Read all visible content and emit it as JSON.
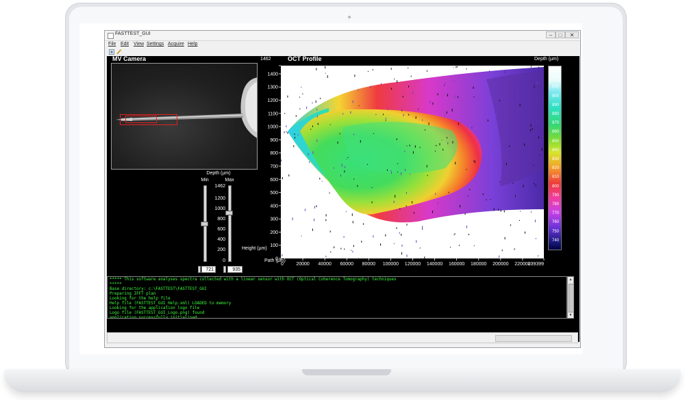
{
  "window": {
    "title": "FASTTEST_GUI",
    "controls": [
      "–",
      "□",
      "✕"
    ]
  },
  "menu": {
    "items": [
      "File",
      "Edit",
      "View",
      "Settings",
      "Acquire",
      "Help"
    ]
  },
  "toolbar": {
    "icons": [
      "settings-icon",
      "probe-icon"
    ]
  },
  "camera_panel": {
    "title": "MV Camera"
  },
  "depth_control": {
    "title": "Depth (µm)",
    "min_label": "Min",
    "max_label": "Max",
    "ticks": [
      "1462",
      "1200",
      "1000",
      "800",
      "600",
      "400",
      "200",
      "0"
    ],
    "min_value": "721",
    "max_value": "935",
    "min_fraction": 0.493,
    "max_fraction": 0.64
  },
  "oct_panel": {
    "title": "OCT Profile",
    "y_axis_title": "Height (µm)",
    "x_axis_title": "Path (µm)",
    "colorbar_title": "Depth (µm)",
    "colorbar_ticks": [
      "935",
      "920",
      "910",
      "900",
      "890",
      "880",
      "870",
      "860",
      "850",
      "840",
      "830",
      "820",
      "810",
      "800",
      "790",
      "780",
      "770",
      "760",
      "750",
      "740"
    ]
  },
  "chart_data": {
    "type": "heatmap",
    "title": "OCT Profile",
    "xlabel": "Path (µm)",
    "ylabel": "Height (µm)",
    "xlim": [
      0,
      239399
    ],
    "ylim": [
      0,
      1462
    ],
    "x_ticks": [
      "0",
      "20000",
      "40000",
      "60000",
      "80000",
      "100000",
      "120000",
      "140000",
      "160000",
      "180000",
      "200000",
      "220000",
      "239399"
    ],
    "y_ticks": [
      "1462",
      "1400",
      "1300",
      "1200",
      "1100",
      "1000",
      "900",
      "800",
      "700",
      "600",
      "500",
      "400",
      "300",
      "200",
      "100",
      "0"
    ],
    "colorbar": {
      "label": "Depth (µm)",
      "min": 721,
      "max": 935
    }
  },
  "console": {
    "lines": [
      "***** This software analyses spectra collected with a linear sensor with OCT (Optical Coherence Tomography) techniques",
      "*****",
      "Base directory: c:\\FASTTEST\\FASTTEST_GUI",
      "Preparing IFFT plan",
      "Looking for the help file",
      "Help file (FASTTEST_GUI_Help.xml) LOADED to memory",
      "Looking for the application logo file",
      "Logo file (FASTTEST_GUI_Logo.png) found",
      "application successfully initialised"
    ]
  }
}
